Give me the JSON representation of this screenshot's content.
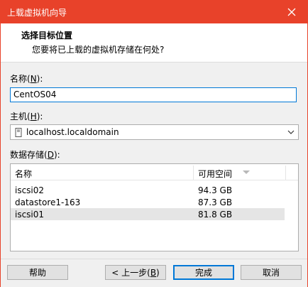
{
  "window": {
    "title": "上载虚拟机向导"
  },
  "header": {
    "title": "选择目标位置",
    "subtitle": "您要将已上载的虚拟机存储在何处?"
  },
  "name_field": {
    "label_prefix": "名称(",
    "label_key": "N",
    "label_suffix": "):",
    "value": "CentOS04"
  },
  "host_field": {
    "label_prefix": "主机(",
    "label_key": "H",
    "label_suffix": "):",
    "value": "localhost.localdomain"
  },
  "datastore": {
    "label_prefix": "数据存储(",
    "label_key": "D",
    "label_suffix": "):",
    "columns": [
      "名称",
      "可用空间"
    ],
    "rows": [
      {
        "name": "iscsi02",
        "free": "94.3 GB",
        "selected": false
      },
      {
        "name": "datastore1-163",
        "free": "87.3 GB",
        "selected": false
      },
      {
        "name": "iscsi01",
        "free": "81.8 GB",
        "selected": true
      }
    ]
  },
  "buttons": {
    "help": "帮助",
    "back_prefix": "< 上一步(",
    "back_key": "B",
    "back_suffix": ")",
    "finish": "完成",
    "cancel": "取消"
  },
  "colors": {
    "titlebar": "#e8422a",
    "focus": "#0078d7",
    "selected_row": "#e5e5e5"
  },
  "icons": {
    "close": "close-icon",
    "host": "server-icon",
    "dropdown": "chevron-down-icon",
    "sort": "sort-desc-icon"
  }
}
